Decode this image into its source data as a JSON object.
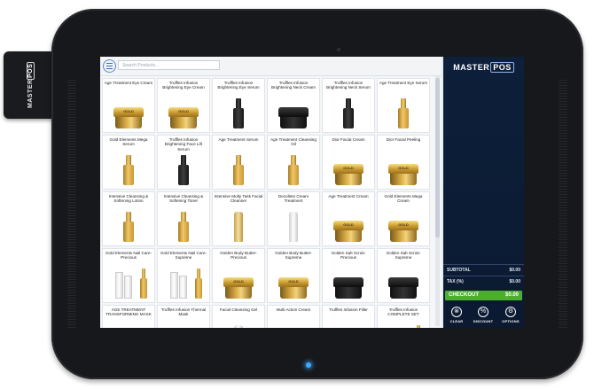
{
  "device": {
    "reader_brand_a": "MASTER",
    "reader_brand_b": "POS"
  },
  "app": {
    "logo_a": "MASTER",
    "logo_b": "POS"
  },
  "search": {
    "placeholder": "Search Products..."
  },
  "products": [
    {
      "name": "Age Treatment Eye Cream",
      "kind": "jar"
    },
    {
      "name": "Truffles Infusion Brightening Eye Cream",
      "kind": "jar"
    },
    {
      "name": "Truffles Infusion Brightening Eye Serum",
      "kind": "bottle-dark"
    },
    {
      "name": "Truffles Infusion Brightening Neck Cream",
      "kind": "black-jar"
    },
    {
      "name": "Truffles Infusion Brightening Neck Serum",
      "kind": "bottle-dark"
    },
    {
      "name": "Age Treatment Eye Serum",
      "kind": "bottle"
    },
    {
      "name": "Gold Elements Mega Serum",
      "kind": "bottle"
    },
    {
      "name": "Truffles Infusion Brightening Face Lift Serum",
      "kind": "bottle-dark"
    },
    {
      "name": "Age Treatment Serum",
      "kind": "bottle"
    },
    {
      "name": "Age Treatment Cleansing Oil",
      "kind": "bottle"
    },
    {
      "name": "Dior Facial Cream",
      "kind": "jar"
    },
    {
      "name": "Dior Facial Peeling",
      "kind": "jar"
    },
    {
      "name": "Intensive Cleansing & Softening Lotion",
      "kind": "bottle"
    },
    {
      "name": "Intensive Cleansing & Softening Toner",
      "kind": "bottle"
    },
    {
      "name": "Intensive Multy Task Facial Cleanser",
      "kind": "tube-gold"
    },
    {
      "name": "Decollete Cream Treatment",
      "kind": "tube"
    },
    {
      "name": "Age Treatment Cream",
      "kind": "jar"
    },
    {
      "name": "Gold Elements Mega Cream",
      "kind": "jar"
    },
    {
      "name": "Gold Elements Nail Care-Precious",
      "kind": "set"
    },
    {
      "name": "Gold Elements Nail Care-Supreme",
      "kind": "set"
    },
    {
      "name": "Golden Body Butter-Precious",
      "kind": "jar"
    },
    {
      "name": "Golden Body Butter-Supreme",
      "kind": "jar"
    },
    {
      "name": "Golden Salt Scrub-Precious",
      "kind": "black-jar"
    },
    {
      "name": "Golden Salt Scrub-Supreme",
      "kind": "black-jar"
    },
    {
      "name": "AGE TREATMENT TRANSFORMING MASK",
      "kind": "jar"
    },
    {
      "name": "Truffles Infusion Thermal Mask",
      "kind": "jar"
    },
    {
      "name": "Facial Cleansing Gel",
      "kind": "tube"
    },
    {
      "name": "Multi Action Cream",
      "kind": "jar"
    },
    {
      "name": "Truffles Infusion Filler",
      "kind": "jar"
    },
    {
      "name": "Truffles Infusion COMPLETE SET",
      "kind": "set"
    }
  ],
  "product_label": "GOLD",
  "totals": {
    "subtotal_label": "SUBTOTAL",
    "subtotal_value": "$0.00",
    "tax_label": "TAX (%)",
    "tax_value": "$0.00"
  },
  "checkout": {
    "label": "CHECKOUT",
    "value": "$0.00"
  },
  "actions": [
    {
      "label": "CLEAR",
      "icon": "⊗"
    },
    {
      "label": "DISCOUNT",
      "icon": "%"
    },
    {
      "label": "OPTIONS",
      "icon": "⚙"
    }
  ],
  "colors": {
    "sidebar": "#0d1f3a",
    "checkout": "#4cae2f",
    "accent": "#3b6fb6"
  }
}
